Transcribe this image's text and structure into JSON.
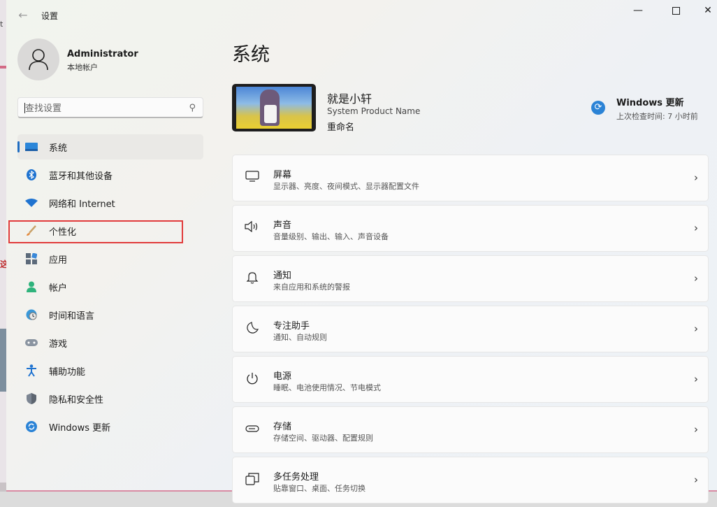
{
  "window": {
    "title": "设置",
    "back_icon": "back-arrow-icon"
  },
  "profile": {
    "name": "Administrator",
    "type": "本地帐户"
  },
  "search": {
    "placeholder": "查找设置",
    "icon": "search-icon"
  },
  "nav": {
    "items": [
      {
        "label": "系统",
        "icon": "system-display-icon",
        "active": true
      },
      {
        "label": "蓝牙和其他设备",
        "icon": "bluetooth-icon"
      },
      {
        "label": "网络和 Internet",
        "icon": "wifi-icon"
      },
      {
        "label": "个性化",
        "icon": "brush-icon",
        "highlighted": true
      },
      {
        "label": "应用",
        "icon": "apps-icon"
      },
      {
        "label": "帐户",
        "icon": "account-icon"
      },
      {
        "label": "时间和语言",
        "icon": "globe-clock-icon"
      },
      {
        "label": "游戏",
        "icon": "gamepad-icon"
      },
      {
        "label": "辅助功能",
        "icon": "accessibility-icon"
      },
      {
        "label": "隐私和安全性",
        "icon": "shield-icon"
      },
      {
        "label": "Windows 更新",
        "icon": "windows-update-icon"
      }
    ]
  },
  "main": {
    "title": "系统",
    "device": {
      "name": "就是小轩",
      "model": "System Product Name",
      "rename": "重命名"
    },
    "update": {
      "title": "Windows 更新",
      "status": "上次检查时间: 7 小时前"
    },
    "cards": [
      {
        "title": "屏幕",
        "subtitle": "显示器、亮度、夜间模式、显示器配置文件",
        "icon": "monitor-icon"
      },
      {
        "title": "声音",
        "subtitle": "音量级别、输出、输入、声音设备",
        "icon": "speaker-icon"
      },
      {
        "title": "通知",
        "subtitle": "来自应用和系统的警报",
        "icon": "bell-icon"
      },
      {
        "title": "专注助手",
        "subtitle": "通知、自动规则",
        "icon": "moon-icon"
      },
      {
        "title": "电源",
        "subtitle": "睡眠、电池使用情况、节电模式",
        "icon": "power-icon"
      },
      {
        "title": "存储",
        "subtitle": "存储空间、驱动器、配置规则",
        "icon": "storage-icon"
      },
      {
        "title": "多任务处理",
        "subtitle": "贴靠窗口、桌面、任务切换",
        "icon": "multitask-icon"
      }
    ]
  },
  "colors": {
    "accent": "#1f6dc1",
    "highlight_box": "#e13b3b"
  }
}
